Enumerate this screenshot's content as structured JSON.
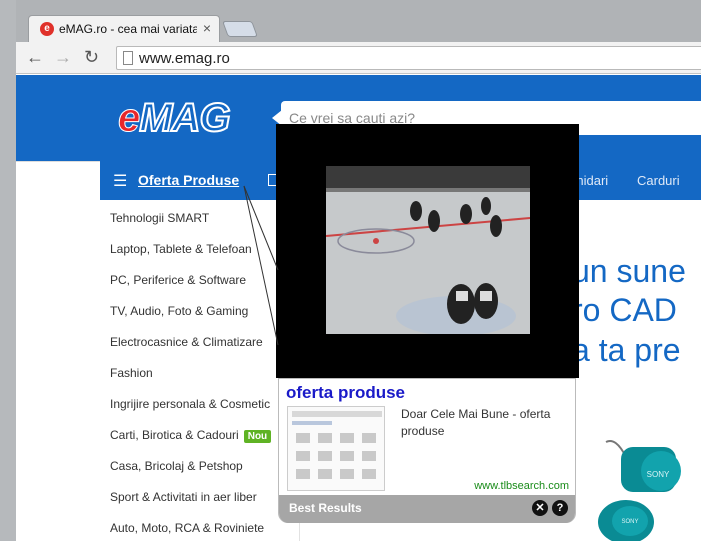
{
  "browser": {
    "tab_title": "eMAG.ro - cea mai variata",
    "tab_favicon_letter": "e",
    "tab_close": "×",
    "url": "www.emag.ro"
  },
  "site": {
    "logo_e": "e",
    "logo_mag": "MAG",
    "search_placeholder": "Ce vrei sa cauti azi?",
    "nav": {
      "oferta": "Oferta Produse",
      "item_1": "ichidari",
      "item_2": "Carduri"
    },
    "sidebar": [
      "Tehnologii SMART",
      "Laptop, Tablete & Telefoan",
      "PC, Periferice & Software",
      "TV, Audio, Foto & Gaming",
      "Electrocasnice & Climatizare",
      "Fashion",
      "Ingrijire personala & Cosmetic",
      "Carti, Birotica & Cadouri",
      "Casa, Bricolaj & Petshop",
      "Sport & Activitati in aer liber",
      "Auto, Moto, RCA & Roviniete"
    ],
    "nou_badge": "Nou",
    "promo_lines": [
      "un sune",
      "ro CAD",
      "a ta pre"
    ],
    "earphone_brand": "SONY"
  },
  "popup": {
    "title": "oferta produse",
    "description": "Doar Cele Mai Bune - oferta produse",
    "url": "www.tlbsearch.com",
    "footer_label": "Best Results",
    "close_glyph": "✕",
    "help_glyph": "?"
  },
  "colors": {
    "emag_blue": "#1468c4",
    "emag_red": "#e8262b",
    "ad_title": "#1a1ac8",
    "ad_url": "#1a8c1a",
    "nou_green": "#5fb324"
  }
}
